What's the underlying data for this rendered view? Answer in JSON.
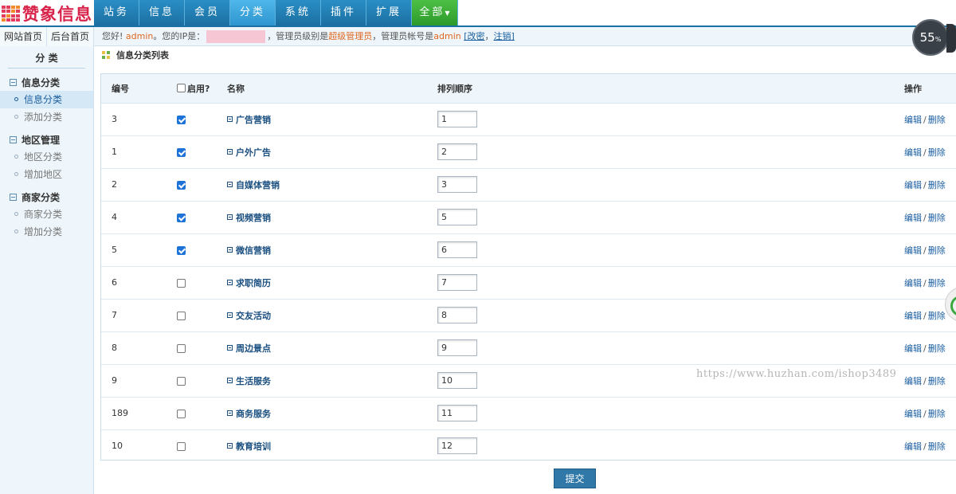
{
  "app": {
    "logo_text": "赞象信息"
  },
  "nav": {
    "tabs": [
      {
        "label": "站务",
        "active": false
      },
      {
        "label": "信息",
        "active": false
      },
      {
        "label": "会员",
        "active": false
      },
      {
        "label": "分类",
        "active": true
      },
      {
        "label": "系统",
        "active": false
      },
      {
        "label": "插件",
        "active": false
      },
      {
        "label": "扩展",
        "active": false
      }
    ],
    "all_label": "全部"
  },
  "quicklinks": {
    "site_home": "网站首页",
    "admin_home": "后台首页"
  },
  "welcome": {
    "greeting": "您好!",
    "username": "admin",
    "ip_prefix": "。您的IP是：",
    "level_prefix": "，管理员级别是",
    "level": "超级管理员",
    "account_prefix": "，管理员帐号是",
    "account": "admin",
    "change_password": "[改密",
    "comma": "，",
    "logout": "注销]"
  },
  "sidebar": {
    "title": "分 类",
    "groups": [
      {
        "label": "信息分类",
        "items": [
          {
            "label": "信息分类",
            "active": true
          },
          {
            "label": "添加分类",
            "active": false
          }
        ]
      },
      {
        "label": "地区管理",
        "items": [
          {
            "label": "地区分类",
            "active": false
          },
          {
            "label": "增加地区",
            "active": false
          }
        ]
      },
      {
        "label": "商家分类",
        "items": [
          {
            "label": "商家分类",
            "active": false
          },
          {
            "label": "增加分类",
            "active": false
          }
        ]
      }
    ]
  },
  "page": {
    "title": "信息分类列表"
  },
  "table": {
    "headers": {
      "id": "编号",
      "enabled": "启用?",
      "name": "名称",
      "order": "排列顺序",
      "ops": "操作"
    },
    "edit_label": "编辑",
    "op_separator": "/",
    "delete_label": "删除",
    "rows": [
      {
        "id": "3",
        "enabled": true,
        "name": "广告营销",
        "order": "1"
      },
      {
        "id": "1",
        "enabled": true,
        "name": "户外广告",
        "order": "2"
      },
      {
        "id": "2",
        "enabled": true,
        "name": "自媒体营销",
        "order": "3"
      },
      {
        "id": "4",
        "enabled": true,
        "name": "视频营销",
        "order": "5"
      },
      {
        "id": "5",
        "enabled": true,
        "name": "微信营销",
        "order": "6"
      },
      {
        "id": "6",
        "enabled": false,
        "name": "求职简历",
        "order": "7"
      },
      {
        "id": "7",
        "enabled": false,
        "name": "交友活动",
        "order": "8"
      },
      {
        "id": "8",
        "enabled": false,
        "name": "周边景点",
        "order": "9"
      },
      {
        "id": "9",
        "enabled": false,
        "name": "生活服务",
        "order": "10"
      },
      {
        "id": "189",
        "enabled": false,
        "name": "商务服务",
        "order": "11"
      },
      {
        "id": "10",
        "enabled": false,
        "name": "教育培训",
        "order": "12"
      }
    ]
  },
  "submit_label": "提交",
  "watermark": "https://www.huzhan.com/ishop3489",
  "speed_widget": {
    "value": "55",
    "unit": "%"
  },
  "colors": {
    "nav_bg": "#1b6ea1",
    "nav_active": "#2f95cf",
    "nav_all": "#2d9a2b",
    "accent_text": "#e0661f",
    "link": "#1a5ea0"
  }
}
